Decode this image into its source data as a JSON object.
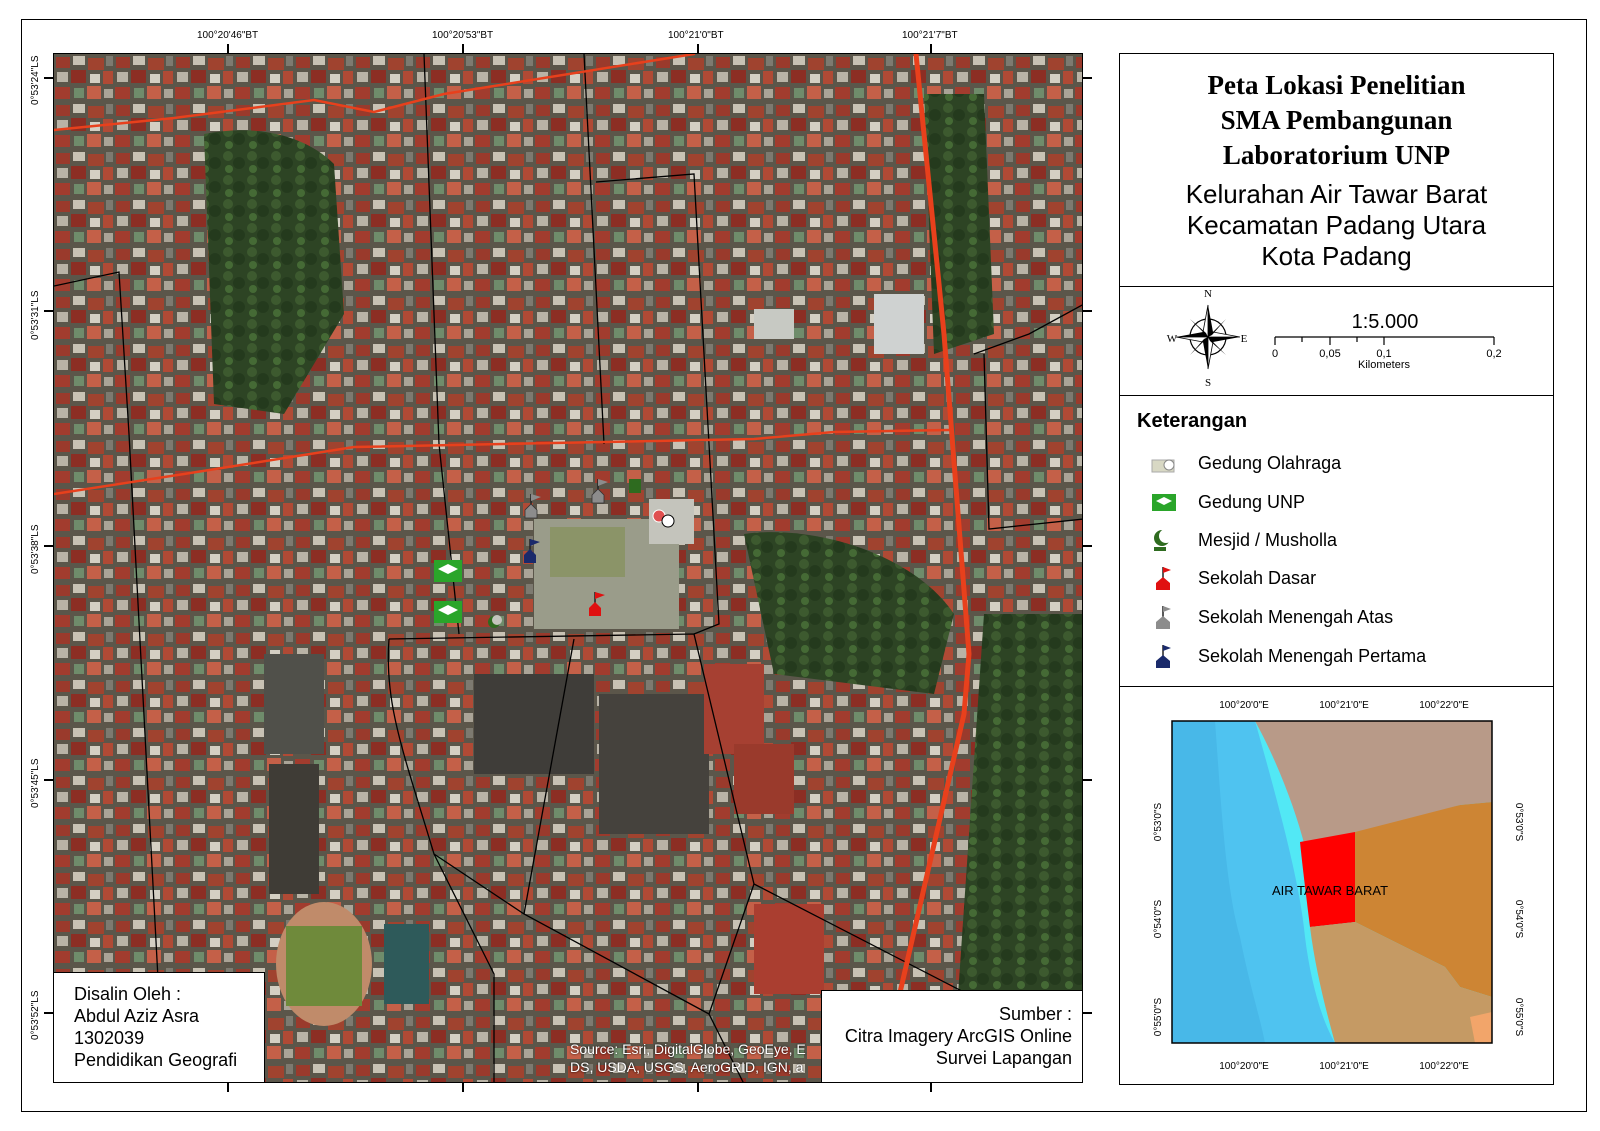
{
  "map": {
    "top_ticks": [
      "100°20'46\"BT",
      "100°20'53\"BT",
      "100°21'0\"BT",
      "100°21'7\"BT"
    ],
    "left_ticks": [
      "0°53'24\"LS",
      "0°53'31\"LS",
      "0°53'38\"LS",
      "0°53'45\"LS",
      "0°53'52\"LS"
    ],
    "basemap_credit": "Source: Esri, DigitalGlobe, GeoEye, E\nDS, USDA, USGS, AeroGRID, IGN, a",
    "colors": {
      "main_road": "#e8401c",
      "minor_road": "#000000",
      "vegetation": "#2f4a26"
    }
  },
  "copied_by": {
    "label": "Disalin Oleh :",
    "name": "Abdul Aziz Asra",
    "id": "1302039",
    "dept": "Pendidikan Geografi"
  },
  "source": {
    "label": "Sumber :",
    "line1": "Citra Imagery ArcGIS Online",
    "line2": "Survei Lapangan"
  },
  "title": {
    "line1": "Peta Lokasi Penelitian",
    "line2": "SMA Pembangunan",
    "line3": "Laboratorium UNP",
    "sub1": "Kelurahan Air Tawar Barat",
    "sub2": "Kecamatan Padang Utara",
    "sub3": "Kota Padang"
  },
  "compass": {
    "n": "N",
    "s": "S",
    "e": "E",
    "w": "W"
  },
  "scale": {
    "ratio": "1:5.000",
    "labels": [
      "0",
      "0,05",
      "0,1",
      "0,2"
    ],
    "unit": "Kilometers"
  },
  "legend": {
    "heading": "Keterangan",
    "items": [
      {
        "label": "Gedung Olahraga",
        "icon": "sports-building-icon",
        "color": "#c7c7a0"
      },
      {
        "label": "Gedung UNP",
        "icon": "graduation-cap-icon",
        "color": "#2aa52a"
      },
      {
        "label": "Mesjid / Musholla",
        "icon": "crescent-icon",
        "color": "#2e6b1f"
      },
      {
        "label": "Sekolah Dasar",
        "icon": "red-school-flag-icon",
        "color": "#e01010"
      },
      {
        "label": "Sekolah Menengah Atas",
        "icon": "grey-school-flag-icon",
        "color": "#8c8c8c"
      },
      {
        "label": "Sekolah Menengah Pertama",
        "icon": "blue-school-flag-icon",
        "color": "#1a2a6b"
      }
    ]
  },
  "inset": {
    "label": "AIR TAWAR BARAT",
    "top_ticks": [
      "100°20'0\"E",
      "100°21'0\"E",
      "100°22'0\"E"
    ],
    "bottom_ticks": [
      "100°20'0\"E",
      "100°21'0\"E",
      "100°22'0\"E"
    ],
    "left_ticks": [
      "0°53'0\"S",
      "0°54'0\"S",
      "0°55'0\"S"
    ],
    "right_ticks": [
      "0°53'0\"S",
      "0°54'0\"S",
      "0°55'0\"S"
    ],
    "colors": {
      "sea_deep": "#4fc3f0",
      "sea_shallow": "#52e8f5",
      "north": "#b89a88",
      "kelurahan": "#ff0000",
      "east": "#cd8534",
      "south": "#c59a64"
    }
  }
}
